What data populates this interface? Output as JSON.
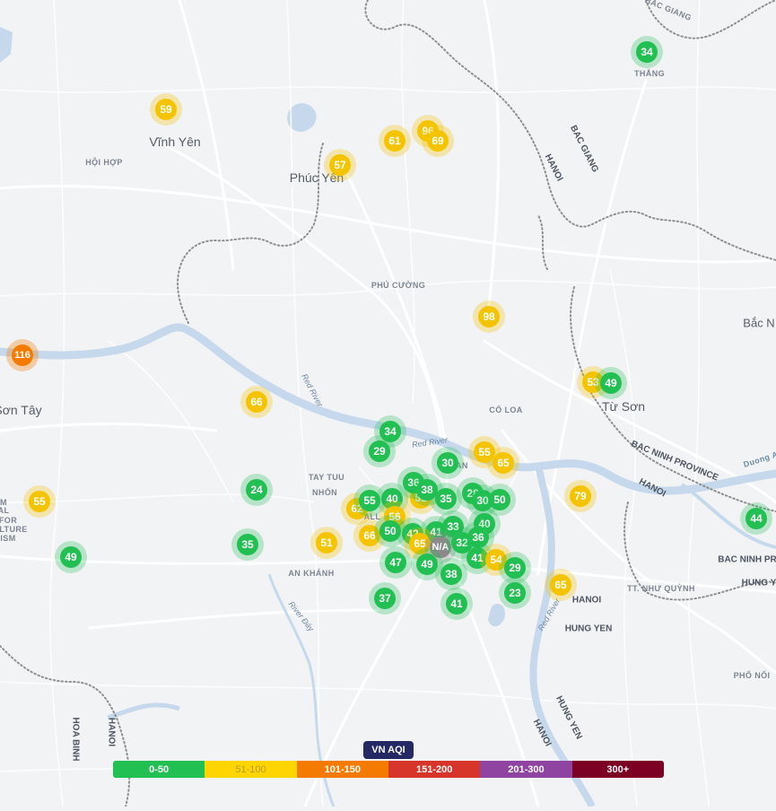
{
  "colors": {
    "good": "#22bf52",
    "moderate": "#f5c400",
    "usg": "#f47a00",
    "unhealthy": "#d8352a",
    "very_unhealthy": "#8e44a0",
    "hazardous": "#7b0023",
    "na": "#8a8a8a",
    "river": "#c6d9ec",
    "road": "#ffffff",
    "border": "#8f8f8f"
  },
  "places": {
    "bac_giang_top": "BẮC GIANG",
    "thang": "THẮNG",
    "vinh_yen": "Vĩnh Yên",
    "hoi_hop": "HỘI HỢP",
    "phuc_yen": "Phúc Yên",
    "phu_cuong": "PHÚ CƯỜNG",
    "bac_giang_side": "BAC GIANG",
    "hanoi_a": "HANOI",
    "bac_n": "Bắc N",
    "son_tay": "Sơn Tây",
    "co_loa": "CỔ LOA",
    "tu_son": "Từ Sơn",
    "bac_ninh_province": "BAC NINH PROVINCE",
    "hanoi_b": "HANOI",
    "duong_a": "Duong A",
    "tay_tuu": "TAY TUU",
    "nhon": "NHỔN",
    "an_khanh": "AN KHÁNH",
    "bac_ninh_pr": "BAC NINH PR",
    "hung_y": "HUNG Y",
    "tu_nhu_quynh": "TT. NHƯ QUỲNH",
    "hanoi_c": "HANOI",
    "hung_yen": "HUNG YEN",
    "phu_noi": "PHỐ NỐI",
    "hoa_binh": "HOA BINH",
    "hanoi_d": "HANOI",
    "hung_yen_b": "HUNG YEN",
    "hanoi_e": "HANOI",
    "for": "FOR",
    "lture": "LTURE",
    "ism": "ISM",
    "al": "AL",
    "m": "M",
    "all": "ALL",
    "nhan": "NHAN"
  },
  "rivers": {
    "red_river_a": "Red River",
    "red_river_b": "Red River",
    "red_river_c": "Red River",
    "river_day": "River Đáy"
  },
  "stations": [
    {
      "value": "34",
      "level": "good"
    },
    {
      "value": "59",
      "level": "mod"
    },
    {
      "value": "61",
      "level": "mod"
    },
    {
      "value": "96",
      "level": "mod"
    },
    {
      "value": "69",
      "level": "mod"
    },
    {
      "value": "57",
      "level": "mod"
    },
    {
      "value": "98",
      "level": "mod"
    },
    {
      "value": "116",
      "level": "usg"
    },
    {
      "value": "66",
      "level": "mod"
    },
    {
      "value": "53",
      "level": "mod"
    },
    {
      "value": "49",
      "level": "good"
    },
    {
      "value": "34",
      "level": "good"
    },
    {
      "value": "29",
      "level": "good"
    },
    {
      "value": "30",
      "level": "good"
    },
    {
      "value": "55",
      "level": "mod"
    },
    {
      "value": "65",
      "level": "mod"
    },
    {
      "value": "55",
      "level": "mod"
    },
    {
      "value": "24",
      "level": "good"
    },
    {
      "value": "79",
      "level": "mod"
    },
    {
      "value": "44",
      "level": "good"
    },
    {
      "value": "62",
      "level": "mod"
    },
    {
      "value": "55",
      "level": "good"
    },
    {
      "value": "40",
      "level": "good"
    },
    {
      "value": "51",
      "level": "mod"
    },
    {
      "value": "56",
      "level": "mod"
    },
    {
      "value": "36",
      "level": "good"
    },
    {
      "value": "38",
      "level": "good"
    },
    {
      "value": "35",
      "level": "good"
    },
    {
      "value": "28",
      "level": "good"
    },
    {
      "value": "30",
      "level": "good"
    },
    {
      "value": "50",
      "level": "good"
    },
    {
      "value": "35",
      "level": "good"
    },
    {
      "value": "49",
      "level": "good"
    },
    {
      "value": "51",
      "level": "mod"
    },
    {
      "value": "66",
      "level": "mod"
    },
    {
      "value": "50",
      "level": "good"
    },
    {
      "value": "42",
      "level": "good"
    },
    {
      "value": "41",
      "level": "good"
    },
    {
      "value": "33",
      "level": "good"
    },
    {
      "value": "40",
      "level": "good"
    },
    {
      "value": "65",
      "level": "mod"
    },
    {
      "value": "N/A",
      "level": "na"
    },
    {
      "value": "32",
      "level": "good"
    },
    {
      "value": "36",
      "level": "good"
    },
    {
      "value": "47",
      "level": "good"
    },
    {
      "value": "49",
      "level": "good"
    },
    {
      "value": "41",
      "level": "good"
    },
    {
      "value": "54",
      "level": "mod"
    },
    {
      "value": "29",
      "level": "good"
    },
    {
      "value": "38",
      "level": "good"
    },
    {
      "value": "23",
      "level": "good"
    },
    {
      "value": "65",
      "level": "mod"
    },
    {
      "value": "37",
      "level": "good"
    },
    {
      "value": "41",
      "level": "good"
    },
    {
      "value": "55",
      "level": "mod"
    }
  ],
  "legend": {
    "title": "VN AQI",
    "segments": [
      "0-50",
      "51-100",
      "101-150",
      "151-200",
      "201-300",
      "300+"
    ]
  }
}
